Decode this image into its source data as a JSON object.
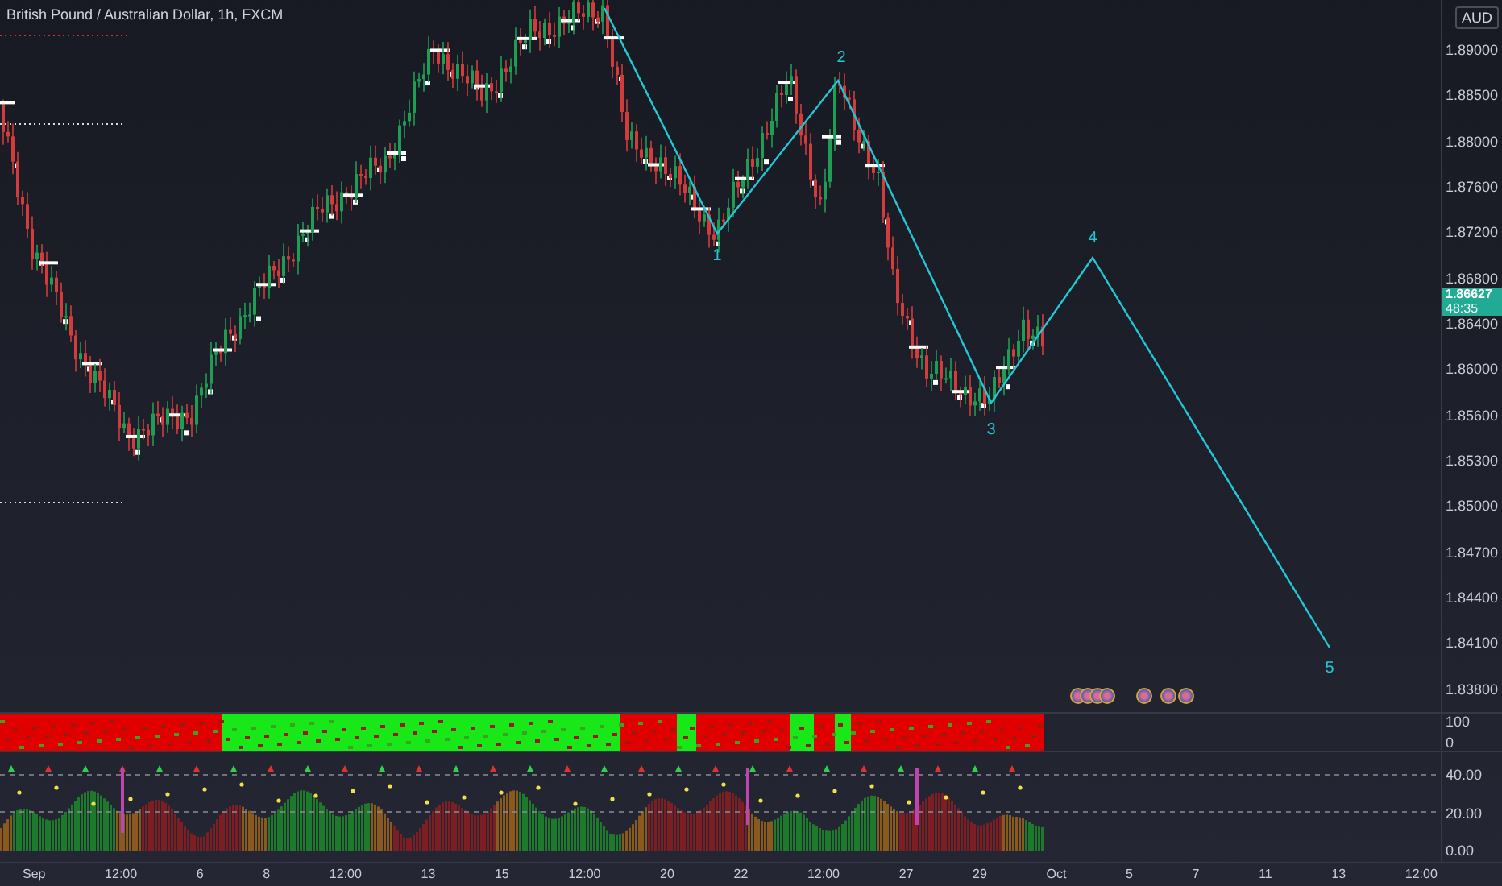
{
  "title": "British Pound / Australian Dollar, 1h, FXCM",
  "currency_button": "AUD",
  "price_axis": {
    "labels": [
      "1.89000",
      "1.88500",
      "1.88000",
      "1.87600",
      "1.87200",
      "1.86800",
      "1.86400",
      "1.86000",
      "1.85600",
      "1.85300",
      "1.85000",
      "1.84700",
      "1.84400",
      "1.84100",
      "1.83800"
    ]
  },
  "last_price": {
    "price": "1.86627",
    "countdown": "48:35"
  },
  "wave_labels": [
    "1",
    "2",
    "3",
    "4",
    "5"
  ],
  "panel_1_axis": [
    "100",
    "0"
  ],
  "panel_2_axis": [
    "40.00",
    "20.00",
    "0.00"
  ],
  "time_axis": [
    "Sep",
    "12:00",
    "6",
    "8",
    "12:00",
    "13",
    "15",
    "12:00",
    "20",
    "22",
    "12:00",
    "27",
    "29",
    "Oct",
    "5",
    "7",
    "11",
    "13",
    "12:00"
  ]
}
